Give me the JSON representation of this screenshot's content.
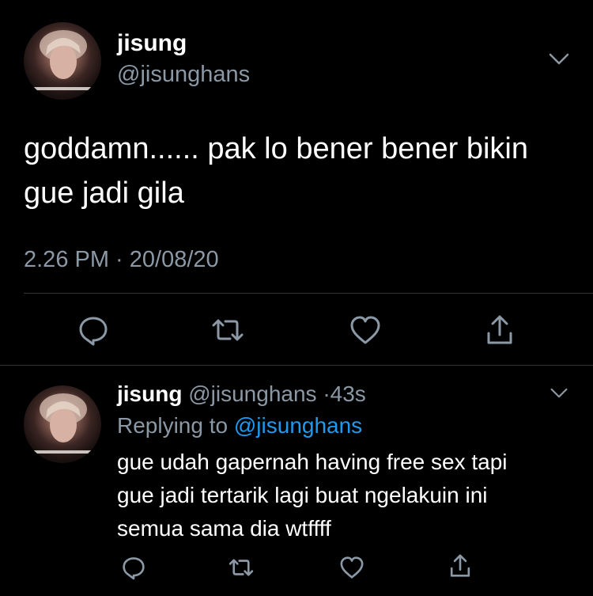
{
  "main_tweet": {
    "display_name": "jisung",
    "handle": "@jisunghans",
    "text": "goddamn...... pak lo bener bener bikin\ngue jadi gila",
    "timestamp": "2.26 PM · 20/08/20"
  },
  "reply_tweet": {
    "display_name": "jisung",
    "handle": "@jisunghans",
    "separator": "·",
    "age": "43s",
    "replying_to_label": "Replying to",
    "replying_to_handle": "@jisunghans",
    "text": "gue udah gapernah having free sex tapi\ngue jadi tertarik lagi buat ngelakuin ini\nsemua sama dia wtffff"
  },
  "icons": {
    "reply": "reply-icon",
    "retweet": "retweet-icon",
    "like": "heart-icon",
    "share": "share-icon",
    "more": "chevron-down-icon"
  },
  "colors": {
    "background": "#000000",
    "text_primary": "#ffffff",
    "text_secondary": "#8b98a5",
    "link": "#1d9bf0",
    "divider": "#2f3336"
  }
}
